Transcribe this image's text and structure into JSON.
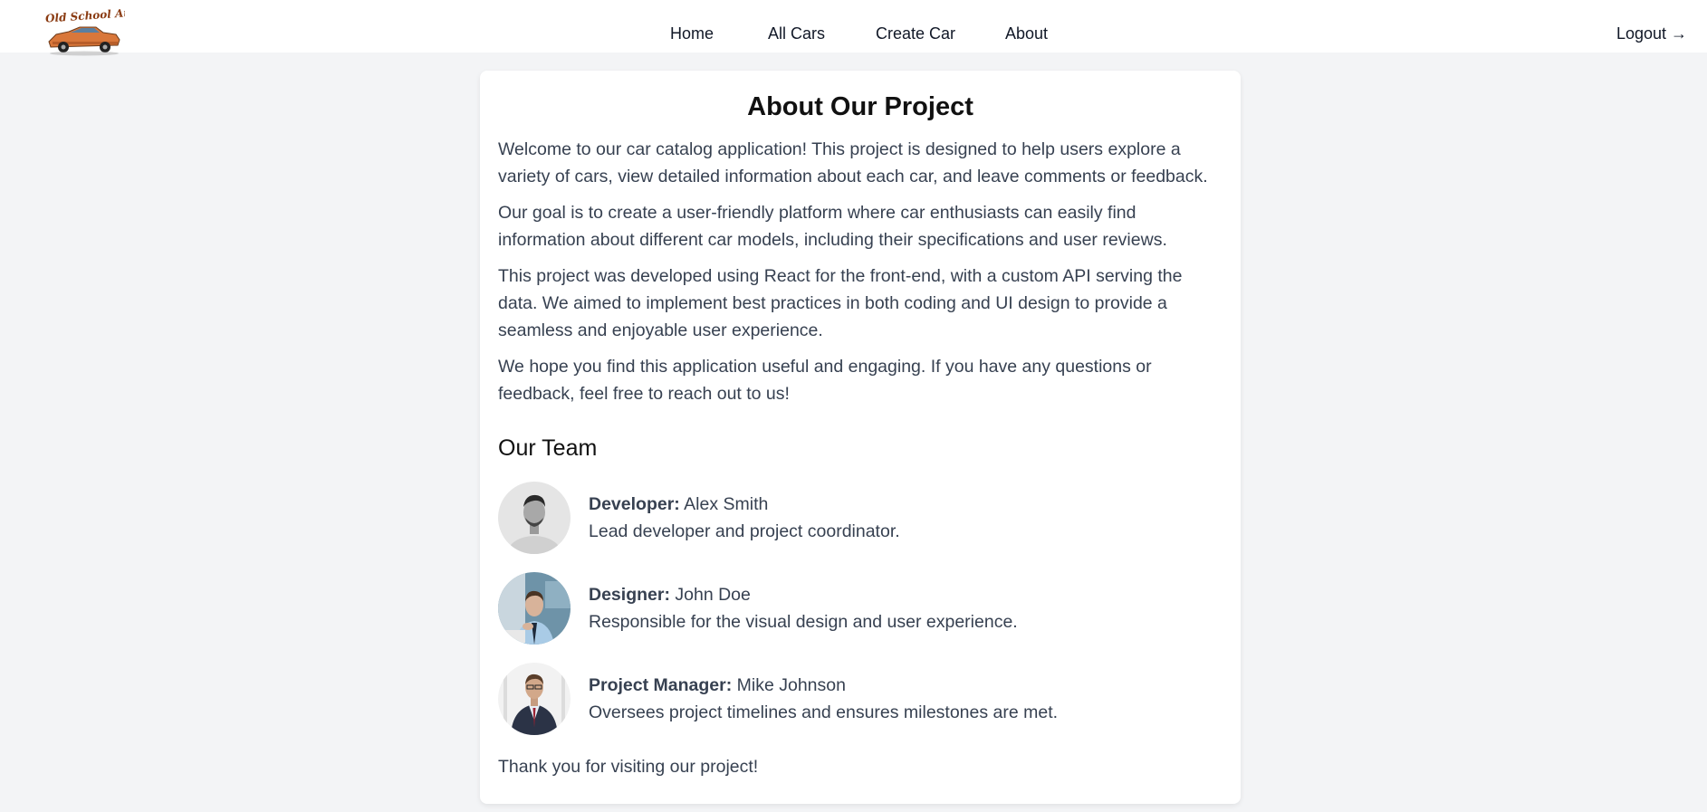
{
  "brand": {
    "logo_text": "Old School Autos"
  },
  "nav": {
    "items": [
      {
        "label": "Home"
      },
      {
        "label": "All Cars"
      },
      {
        "label": "Create Car"
      },
      {
        "label": "About"
      }
    ],
    "logout_label": "Logout →"
  },
  "about": {
    "title": "About Our Project",
    "paragraphs": [
      "Welcome to our car catalog application! This project is designed to help users explore a variety of cars, view detailed information about each car, and leave comments or feedback.",
      "Our goal is to create a user-friendly platform where car enthusiasts can easily find information about different car models, including their specifications and user reviews.",
      "This project was developed using React for the front-end, with a custom API serving the data. We aimed to implement best practices in both coding and UI design to provide a seamless and enjoyable user experience.",
      "We hope you find this application useful and engaging. If you have any questions or feedback, feel free to reach out to us!"
    ],
    "team_heading": "Our Team",
    "team": [
      {
        "role": "Developer:",
        "name": "Alex Smith",
        "description": "Lead developer and project coordinator."
      },
      {
        "role": "Designer:",
        "name": "John Doe",
        "description": "Responsible for the visual design and user experience."
      },
      {
        "role": "Project Manager:",
        "name": "Mike Johnson",
        "description": "Oversees project timelines and ensures milestones are met."
      }
    ],
    "closing": "Thank you for visiting our project!"
  },
  "colors": {
    "background": "#f3f4f6",
    "card": "#ffffff",
    "text": "#374151",
    "heading": "#111111",
    "logo_car": "#d9773a"
  }
}
